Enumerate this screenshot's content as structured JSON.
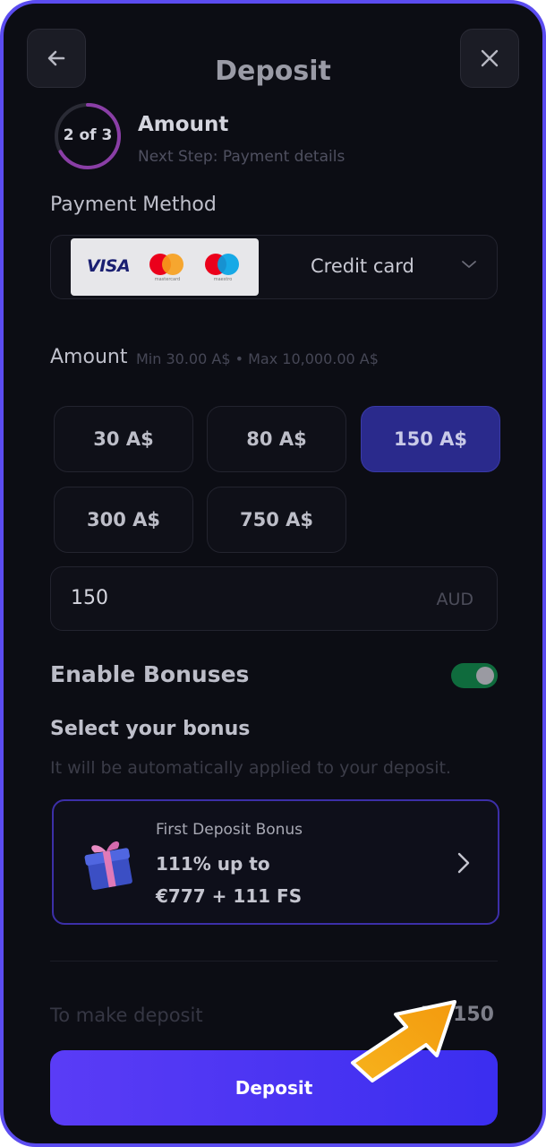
{
  "header": {
    "title": "Deposit",
    "back_icon": "arrow-left-icon",
    "close_icon": "close-icon"
  },
  "step": {
    "indicator": "2 of 3",
    "progress_fraction": 0.667,
    "title": "Amount",
    "next": "Next Step: Payment details"
  },
  "payment": {
    "label": "Payment Method",
    "card_brands": [
      "VISA",
      "mastercard",
      "maestro"
    ],
    "selected": "Credit card",
    "dropdown_icon": "chevron-down-icon"
  },
  "amount": {
    "label": "Amount",
    "range": "Min 30.00 A$ • Max 10,000.00 A$",
    "presets": [
      {
        "label": "30 A$",
        "selected": false
      },
      {
        "label": "80 A$",
        "selected": false
      },
      {
        "label": "150 A$",
        "selected": true
      },
      {
        "label": "300 A$",
        "selected": false
      },
      {
        "label": "750 A$",
        "selected": false
      }
    ],
    "input_value": "150",
    "currency": "AUD"
  },
  "bonuses": {
    "enable_label": "Enable Bonuses",
    "enabled": true,
    "select_title": "Select your bonus",
    "select_subtitle": "It will be automatically applied to your deposit.",
    "card": {
      "name": "First Deposit Bonus",
      "line1": "111% up to",
      "line2": "€777 + 111 FS",
      "icon": "gift-icon"
    }
  },
  "summary": {
    "label": "To make deposit",
    "value": "A$ 150"
  },
  "actions": {
    "deposit_label": "Deposit"
  },
  "colors": {
    "accent": "#4a34f2",
    "selected_chip": "#2a2a8c",
    "frame_border": "#5b4cf0",
    "toggle_on": "#0f6b3d",
    "pointer_arrow": "#f5a412"
  }
}
